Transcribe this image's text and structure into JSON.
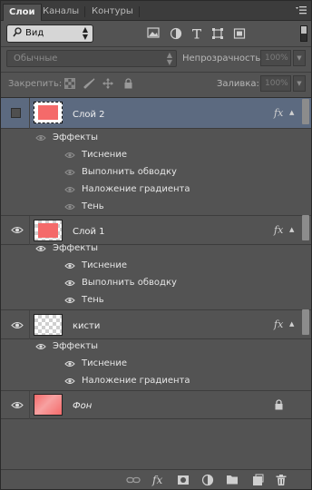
{
  "tabs": [
    "Слои",
    "Каналы",
    "Контуры"
  ],
  "active_tab": "Слои",
  "panel_menu_icon": "panel-menu-icon",
  "filter": {
    "kind_label": "Вид",
    "icons": [
      "image-filter-icon",
      "adjustment-filter-icon",
      "type-filter-icon",
      "shape-filter-icon",
      "smart-object-filter-icon"
    ]
  },
  "blend": {
    "mode": "Обычные",
    "opacity_label": "Непрозрачность:",
    "opacity_value": "100%"
  },
  "lock": {
    "label": "Закрепить:",
    "icons": [
      "lock-transparent-icon",
      "lock-image-icon",
      "lock-position-icon",
      "lock-all-icon"
    ],
    "fill_label": "Заливка:",
    "fill_value": "100%"
  },
  "layers": [
    {
      "name": "Слой 2",
      "selected": true,
      "visible": false,
      "has_fx": true,
      "effects_label": "Эффекты",
      "effects": [
        "Тиснение",
        "Выполнить обводку",
        "Наложение градиента",
        "Тень"
      ]
    },
    {
      "name": "Слой 1",
      "selected": false,
      "visible": true,
      "has_fx": true,
      "effects_label": "Эффекты",
      "effects": [
        "Тиснение",
        "Выполнить обводку",
        "Тень"
      ]
    },
    {
      "name": "кисти",
      "selected": false,
      "visible": true,
      "has_fx": true,
      "effects_label": "Эффекты",
      "effects": [
        "Тиснение",
        "Наложение градиента"
      ]
    },
    {
      "name": "Фон",
      "selected": false,
      "visible": true,
      "has_fx": false,
      "locked": true
    }
  ],
  "fx_symbol": "fx",
  "footer_icons": [
    "link-layers-icon",
    "add-layer-style-icon",
    "add-mask-icon",
    "adjustment-layer-icon",
    "new-group-icon",
    "new-layer-icon",
    "delete-layer-icon"
  ],
  "colors": {
    "panel_bg": "#535353",
    "selected_row": "#5c6a80",
    "thumb_red": "#f46a6a"
  }
}
